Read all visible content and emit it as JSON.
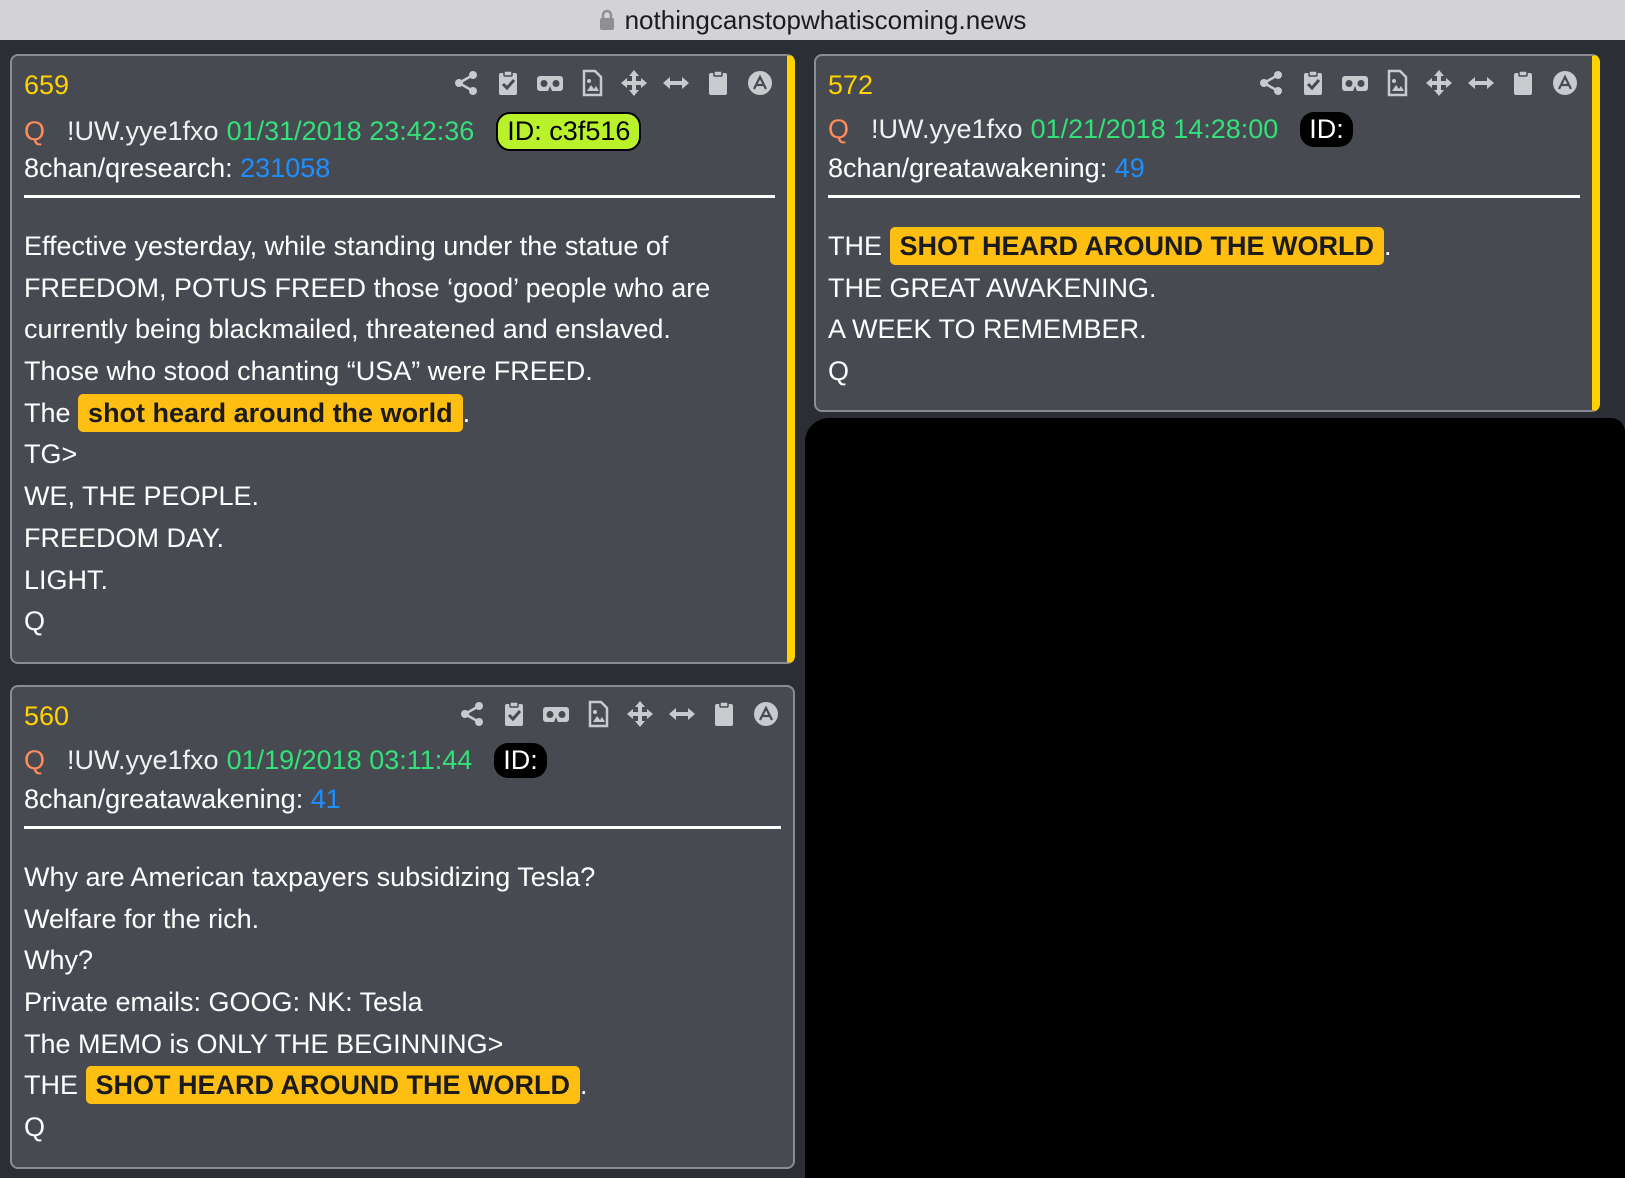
{
  "browser": {
    "url": "nothingcanstopwhatiscoming.news"
  },
  "posts": [
    {
      "number": "659",
      "author": "Q",
      "tripcode": "!UW.yye1fxo",
      "date": "01/31/2018 23:42:36",
      "id_label": "ID: c3f516",
      "board_label": "8chan/qresearch:",
      "board_post": "231058",
      "lines": [
        "Effective yesterday, while standing under the statue of",
        "FREEDOM, POTUS FREED those ‘good’ people who are",
        "currently being blackmailed, threatened and enslaved.",
        "Those who stood chanting “USA” were FREED."
      ],
      "hl_prefix": "The",
      "hl_text": "shot heard around the world",
      "hl_suffix": ".",
      "tail_lines": [
        "TG>",
        "WE, THE PEOPLE.",
        "FREEDOM DAY.",
        "LIGHT.",
        "Q"
      ]
    },
    {
      "number": "572",
      "author": "Q",
      "tripcode": "!UW.yye1fxo",
      "date": "01/21/2018 14:28:00",
      "id_label": "ID:",
      "board_label": "8chan/greatawakening:",
      "board_post": "49",
      "hl_prefix": "THE",
      "hl_text": "SHOT HEARD AROUND THE WORLD",
      "hl_suffix": ".",
      "tail_lines": [
        "THE GREAT AWAKENING.",
        "A WEEK TO REMEMBER.",
        "Q"
      ]
    },
    {
      "number": "560",
      "author": "Q",
      "tripcode": "!UW.yye1fxo",
      "date": "01/19/2018 03:11:44",
      "id_label": "ID:",
      "board_label": "8chan/greatawakening:",
      "board_post": "41",
      "lines": [
        "Why are American taxpayers subsidizing Tesla?",
        "Welfare for the rich.",
        "Why?",
        "Private emails: GOOG: NK: Tesla",
        "The MEMO is ONLY THE BEGINNING>"
      ],
      "hl_prefix": "THE",
      "hl_text": "SHOT HEARD AROUND THE WORLD",
      "hl_suffix": ".",
      "tail_lines": [
        "Q"
      ]
    }
  ],
  "toolbar_icons": [
    "share-icon",
    "clipboard-check-icon",
    "vr-goggles-icon",
    "image-file-icon",
    "move-icon",
    "resize-horizontal-icon",
    "clipboard-icon",
    "scroll-top-icon"
  ],
  "colors": {
    "post_number": "#ffd200",
    "author": "#ff8c5a",
    "date": "#33e07a",
    "board_link": "#1d8fff",
    "highlight": "#ffbe12",
    "id_badge_green": "#b9f22b"
  }
}
